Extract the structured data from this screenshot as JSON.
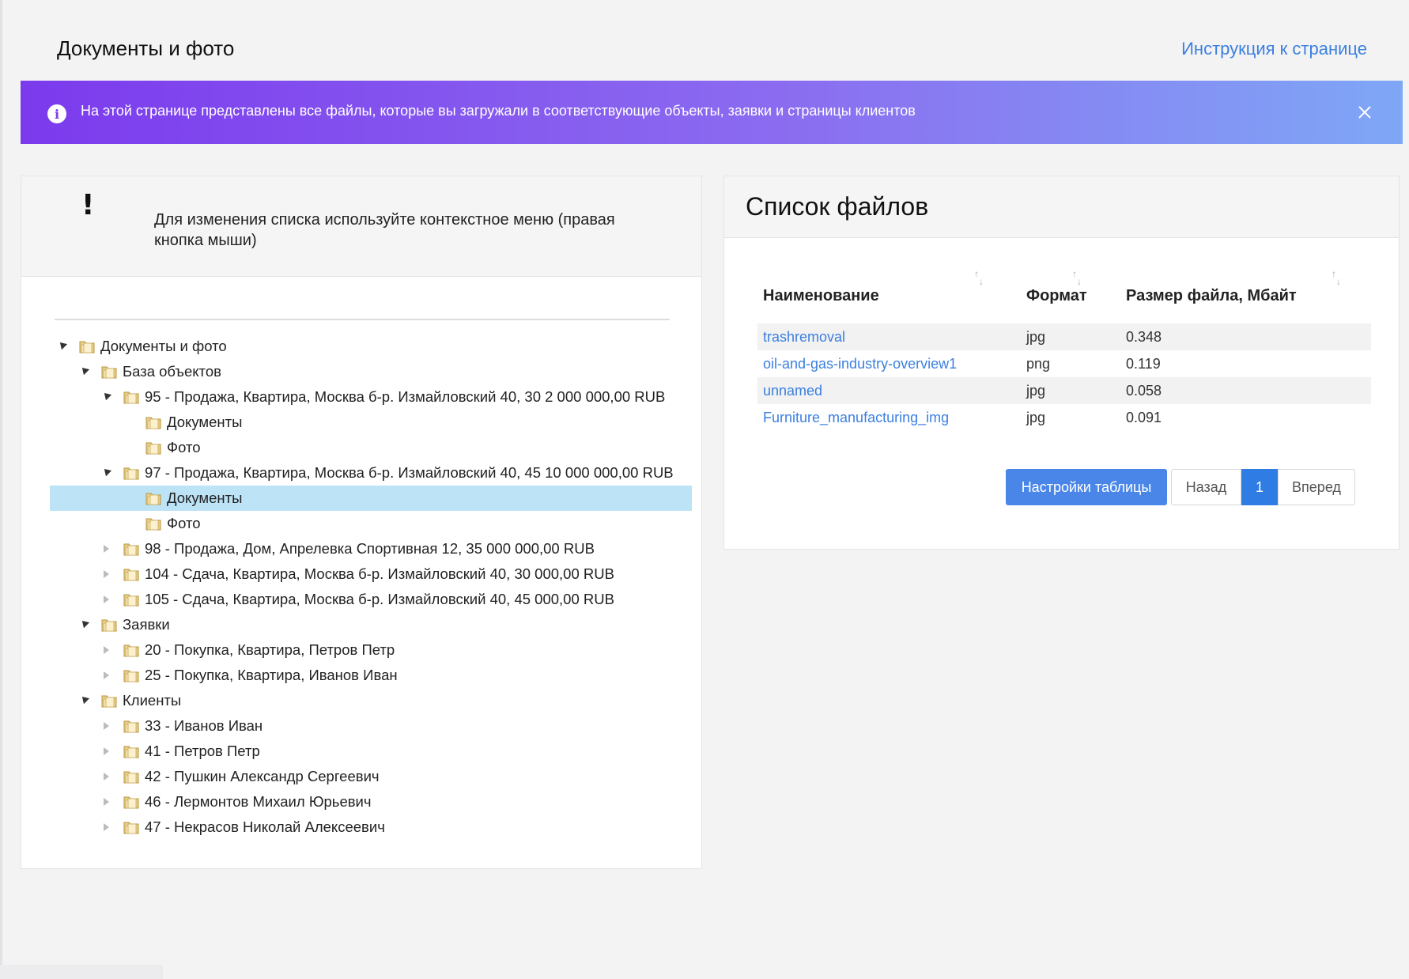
{
  "header": {
    "title": "Документы и фото",
    "help_link": "Инструкция к странице"
  },
  "alert": {
    "icon": "info-icon",
    "text": "На этой странице представлены все файлы, которые вы загружали в соответствующие объекты, заявки и страницы клиентов",
    "close_icon": "close-icon"
  },
  "tree_panel": {
    "hint_mark": "!",
    "hint_text": "Для изменения списка используйте контекстное меню (правая кнопка мыши)",
    "nodes": [
      {
        "label": "Документы и фото",
        "level": 0,
        "state": "open"
      },
      {
        "label": "База объектов",
        "level": 1,
        "state": "open"
      },
      {
        "label": "95 - Продажа, Квартира, Москва б-р. Измайловский 40, 30 2 000 000,00 RUB",
        "level": 2,
        "state": "open"
      },
      {
        "label": "Документы",
        "level": 3,
        "state": "leaf"
      },
      {
        "label": "Фото",
        "level": 3,
        "state": "leaf"
      },
      {
        "label": "97 - Продажа, Квартира, Москва б-р. Измайловский 40, 45 10 000 000,00 RUB",
        "level": 2,
        "state": "open"
      },
      {
        "label": "Документы",
        "level": 3,
        "state": "leaf",
        "selected": true
      },
      {
        "label": "Фото",
        "level": 3,
        "state": "leaf"
      },
      {
        "label": "98 - Продажа, Дом, Апрелевка Спортивная 12, 35 000 000,00 RUB",
        "level": 2,
        "state": "closed"
      },
      {
        "label": "104 - Сдача, Квартира, Москва б-р. Измайловский 40, 30 000,00 RUB",
        "level": 2,
        "state": "closed"
      },
      {
        "label": "105 - Сдача, Квартира, Москва б-р. Измайловский 40, 45 000,00 RUB",
        "level": 2,
        "state": "closed"
      },
      {
        "label": "Заявки",
        "level": 1,
        "state": "open"
      },
      {
        "label": "20 - Покупка, Квартира, Петров Петр",
        "level": 2,
        "state": "closed"
      },
      {
        "label": "25 - Покупка, Квартира, Иванов Иван",
        "level": 2,
        "state": "closed"
      },
      {
        "label": "Клиенты",
        "level": 1,
        "state": "open"
      },
      {
        "label": "33 - Иванов Иван",
        "level": 2,
        "state": "closed"
      },
      {
        "label": "41 - Петров Петр",
        "level": 2,
        "state": "closed"
      },
      {
        "label": "42 - Пушкин Александр Сергеевич",
        "level": 2,
        "state": "closed"
      },
      {
        "label": "46 - Лермонтов Михаил Юрьевич",
        "level": 2,
        "state": "closed"
      },
      {
        "label": "47 - Некрасов Николай Алексеевич",
        "level": 2,
        "state": "closed"
      }
    ]
  },
  "files_panel": {
    "title": "Список файлов",
    "columns": [
      "Наименование",
      "Формат",
      "Размер файла, Мбайт"
    ],
    "rows": [
      {
        "name": "trashremoval",
        "format": "jpg",
        "size": "0.348"
      },
      {
        "name": "oil-and-gas-industry-overview1",
        "format": "png",
        "size": "0.119"
      },
      {
        "name": "unnamed",
        "format": "jpg",
        "size": "0.058"
      },
      {
        "name": "Furniture_manufacturing_img",
        "format": "jpg",
        "size": "0.091"
      }
    ],
    "settings_button": "Настройки таблицы",
    "prev_button": "Назад",
    "current_page": "1",
    "next_button": "Вперед"
  },
  "colors": {
    "accent": "#3b7fe0",
    "alert_start": "#7c3aed",
    "alert_end": "#7fa7f6",
    "selected_row": "#bde3f7"
  }
}
